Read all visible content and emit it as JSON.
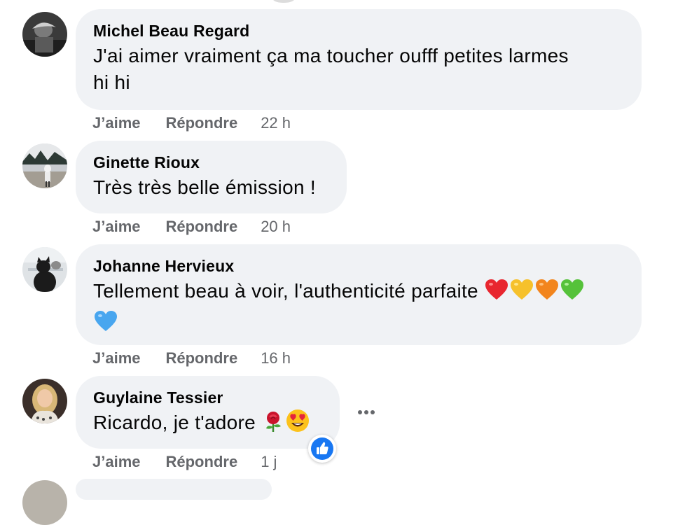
{
  "comments": [
    {
      "author": "Michel Beau Regard",
      "text_line1": "J'ai aimer vraiment ça ma toucher oufff petites larmes",
      "text_line2": "hi hi",
      "like_label": "J’aime",
      "reply_label": "Répondre",
      "time": "22 h"
    },
    {
      "author": "Ginette Rioux",
      "text_line1": "Très très belle émission !",
      "like_label": "J’aime",
      "reply_label": "Répondre",
      "time": "20 h"
    },
    {
      "author": "Johanne Hervieux",
      "text_line1": "Tellement beau à voir, l'authenticité parfaite",
      "emojis_line1": [
        "red-heart",
        "yellow-heart",
        "orange-heart",
        "green-heart"
      ],
      "emojis_line2": [
        "blue-heart"
      ],
      "like_label": "J’aime",
      "reply_label": "Répondre",
      "time": "16 h"
    },
    {
      "author": "Guylaine Tessier",
      "text_line1": "Ricardo, je t'adore",
      "emojis_line1": [
        "rose",
        "heart-eyes-face"
      ],
      "reaction": "like",
      "like_label": "J’aime",
      "reply_label": "Répondre",
      "time": "1 j"
    }
  ],
  "colors": {
    "bubble": "#f0f2f5",
    "author": "#050505",
    "action": "#65676b",
    "like_reaction": "#1877f2"
  }
}
